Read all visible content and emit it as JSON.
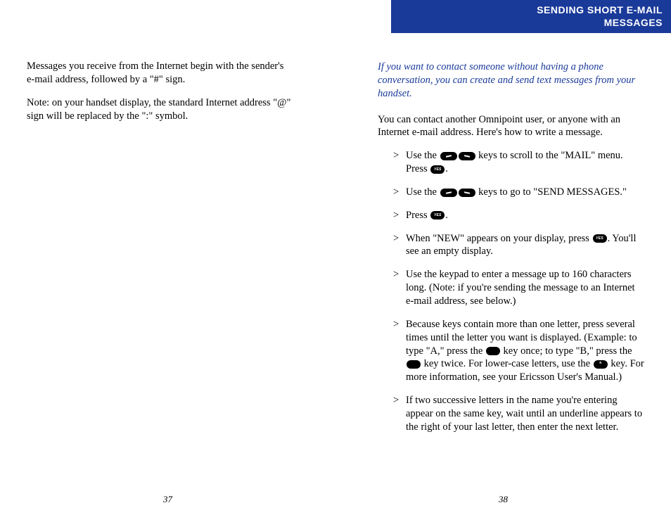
{
  "header": {
    "line1": "SENDING SHORT E-MAIL",
    "line2": "MESSAGES"
  },
  "left": {
    "p1": "Messages you receive from the Internet begin with the sender's e-mail address, followed by a \"#\" sign.",
    "p2": "Note: on your handset display, the standard Internet address \"@\" sign will be replaced by the \":\" symbol.",
    "pageNum": "37"
  },
  "right": {
    "intro": "If you want to contact someone without having a phone conversation, you can create and send text messages from your handset.",
    "p1": "You can contact another Omnipoint user, or anyone with an Internet e-mail address.  Here's how to write a message.",
    "steps": {
      "s1a": "Use the ",
      "s1b": " keys to scroll to the \"MAIL\" menu.  Press ",
      "s1c": ".",
      "s2a": "Use the ",
      "s2b": " keys to go to \"SEND MESSAGES.\"",
      "s3a": "Press ",
      "s3b": ".",
      "s4a": "When \"NEW\" appears on your display, press ",
      "s4b": ".  You'll see an empty display.",
      "s5": "Use the keypad to enter a message up to 160 characters long.  (Note: if you're sending the message to an Internet e-mail address, see below.)",
      "s6a": "Because keys contain more than one letter, press several times until the letter you want is displayed.  (Example: to type \"A,\" press the ",
      "s6b": " key once; to type \"B,\" press the ",
      "s6c": " key twice.  For lower-case letters, use the ",
      "s6d": " key.  For more information, see your Ericsson User's Manual.)",
      "s7": "If two successive letters in the name you're entering appear on the same key, wait until an underline appears to the right of your last letter, then enter the next letter."
    },
    "pageNum": "38"
  }
}
